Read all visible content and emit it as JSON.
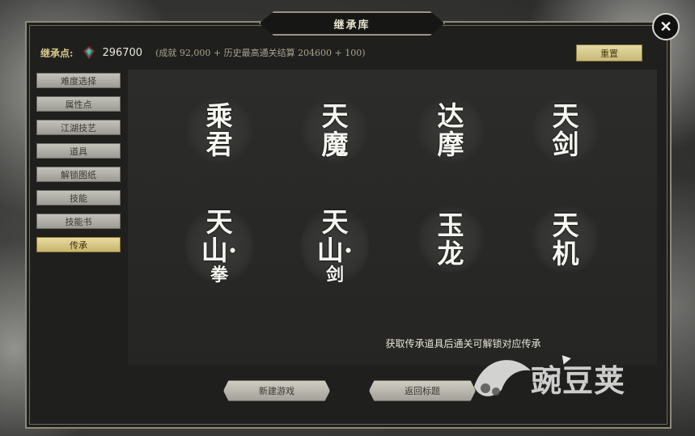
{
  "window": {
    "title": "继承库"
  },
  "header": {
    "points_label": "继承点:",
    "points_value": "296700",
    "points_detail": "(成就 92,000 + 历史最高通关结算 204600 + 100)",
    "reset_label": "重置"
  },
  "sidebar": {
    "items": [
      {
        "label": "难度选择",
        "active": false
      },
      {
        "label": "属性点",
        "active": false
      },
      {
        "label": "江湖技艺",
        "active": false
      },
      {
        "label": "道具",
        "active": false
      },
      {
        "label": "解锁图纸",
        "active": false
      },
      {
        "label": "技能",
        "active": false
      },
      {
        "label": "技能书",
        "active": false
      },
      {
        "label": "传承",
        "active": true
      }
    ]
  },
  "inheritances": [
    {
      "line1": "乘",
      "line2": "君",
      "line3": ""
    },
    {
      "line1": "天",
      "line2": "魔",
      "line3": ""
    },
    {
      "line1": "达",
      "line2": "摩",
      "line3": ""
    },
    {
      "line1": "天",
      "line2": "剑",
      "line3": ""
    },
    {
      "line1": "天",
      "line2": "山·",
      "line3": "拳"
    },
    {
      "line1": "天",
      "line2": "山·",
      "line3": "剑"
    },
    {
      "line1": "玉",
      "line2": "龙",
      "line3": ""
    },
    {
      "line1": "天",
      "line2": "机",
      "line3": ""
    }
  ],
  "hint_text": "获取传承道具后通关可解锁对应传承",
  "footer": {
    "new_game_label": "新建游戏",
    "back_title_label": "返回标题"
  },
  "watermark": {
    "text": "豌豆荚"
  },
  "colors": {
    "accent_gold": "#d8c98b",
    "frame_border": "#8e8a77",
    "panel_bg": "#2a2a28"
  },
  "icons": {
    "points": "gem-icon",
    "close": "close-x-icon"
  }
}
